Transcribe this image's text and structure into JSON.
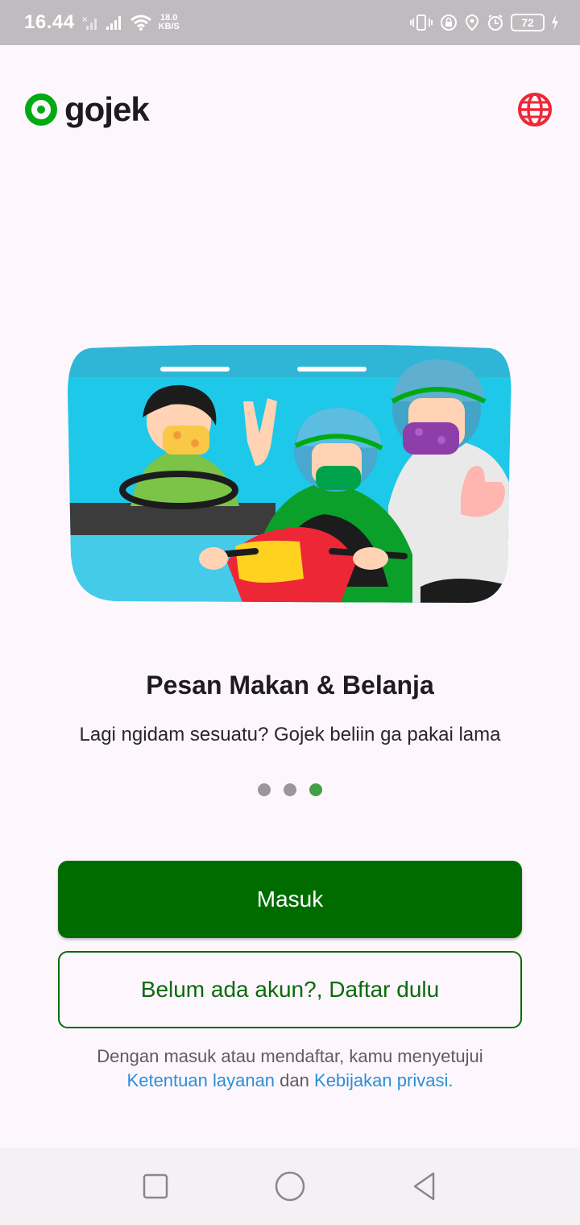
{
  "status_bar": {
    "time": "16.44",
    "net_speed_value": "18.0",
    "net_speed_unit": "KB/S",
    "battery": "72"
  },
  "header": {
    "brand": "gojek",
    "brand_color": "#00aa13",
    "globe_icon": "globe-icon",
    "globe_color": "#ee2737"
  },
  "onboarding": {
    "title": "Pesan Makan & Belanja",
    "subtitle": "Lagi ngidam sesuatu? Gojek beliin ga pakai lama",
    "page_count": 3,
    "active_page": 3
  },
  "actions": {
    "login_label": "Masuk",
    "register_label": "Belum ada akun?, Daftar dulu",
    "primary_color": "#006c00"
  },
  "terms": {
    "prefix": "Dengan masuk atau mendaftar, kamu menyetujui",
    "terms_link": "Ketentuan layanan",
    "conjunction": "dan",
    "privacy_link": "Kebijakan privasi."
  },
  "nav": {
    "recents": "square-icon",
    "home": "circle-icon",
    "back": "triangle-back-icon"
  }
}
